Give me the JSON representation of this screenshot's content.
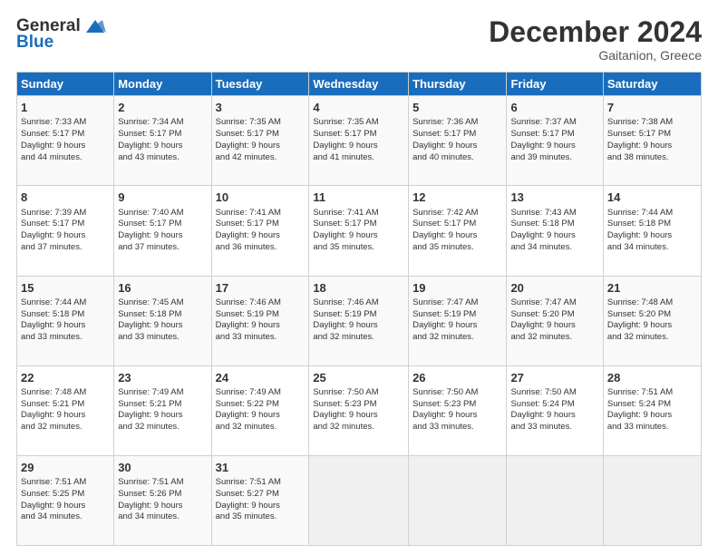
{
  "header": {
    "logo_line1": "General",
    "logo_line2": "Blue",
    "month_title": "December 2024",
    "location": "Gaitanion, Greece"
  },
  "days_of_week": [
    "Sunday",
    "Monday",
    "Tuesday",
    "Wednesday",
    "Thursday",
    "Friday",
    "Saturday"
  ],
  "weeks": [
    [
      {
        "day": "1",
        "info": "Sunrise: 7:33 AM\nSunset: 5:17 PM\nDaylight: 9 hours\nand 44 minutes."
      },
      {
        "day": "2",
        "info": "Sunrise: 7:34 AM\nSunset: 5:17 PM\nDaylight: 9 hours\nand 43 minutes."
      },
      {
        "day": "3",
        "info": "Sunrise: 7:35 AM\nSunset: 5:17 PM\nDaylight: 9 hours\nand 42 minutes."
      },
      {
        "day": "4",
        "info": "Sunrise: 7:35 AM\nSunset: 5:17 PM\nDaylight: 9 hours\nand 41 minutes."
      },
      {
        "day": "5",
        "info": "Sunrise: 7:36 AM\nSunset: 5:17 PM\nDaylight: 9 hours\nand 40 minutes."
      },
      {
        "day": "6",
        "info": "Sunrise: 7:37 AM\nSunset: 5:17 PM\nDaylight: 9 hours\nand 39 minutes."
      },
      {
        "day": "7",
        "info": "Sunrise: 7:38 AM\nSunset: 5:17 PM\nDaylight: 9 hours\nand 38 minutes."
      }
    ],
    [
      {
        "day": "8",
        "info": "Sunrise: 7:39 AM\nSunset: 5:17 PM\nDaylight: 9 hours\nand 37 minutes."
      },
      {
        "day": "9",
        "info": "Sunrise: 7:40 AM\nSunset: 5:17 PM\nDaylight: 9 hours\nand 37 minutes."
      },
      {
        "day": "10",
        "info": "Sunrise: 7:41 AM\nSunset: 5:17 PM\nDaylight: 9 hours\nand 36 minutes."
      },
      {
        "day": "11",
        "info": "Sunrise: 7:41 AM\nSunset: 5:17 PM\nDaylight: 9 hours\nand 35 minutes."
      },
      {
        "day": "12",
        "info": "Sunrise: 7:42 AM\nSunset: 5:17 PM\nDaylight: 9 hours\nand 35 minutes."
      },
      {
        "day": "13",
        "info": "Sunrise: 7:43 AM\nSunset: 5:18 PM\nDaylight: 9 hours\nand 34 minutes."
      },
      {
        "day": "14",
        "info": "Sunrise: 7:44 AM\nSunset: 5:18 PM\nDaylight: 9 hours\nand 34 minutes."
      }
    ],
    [
      {
        "day": "15",
        "info": "Sunrise: 7:44 AM\nSunset: 5:18 PM\nDaylight: 9 hours\nand 33 minutes."
      },
      {
        "day": "16",
        "info": "Sunrise: 7:45 AM\nSunset: 5:18 PM\nDaylight: 9 hours\nand 33 minutes."
      },
      {
        "day": "17",
        "info": "Sunrise: 7:46 AM\nSunset: 5:19 PM\nDaylight: 9 hours\nand 33 minutes."
      },
      {
        "day": "18",
        "info": "Sunrise: 7:46 AM\nSunset: 5:19 PM\nDaylight: 9 hours\nand 32 minutes."
      },
      {
        "day": "19",
        "info": "Sunrise: 7:47 AM\nSunset: 5:19 PM\nDaylight: 9 hours\nand 32 minutes."
      },
      {
        "day": "20",
        "info": "Sunrise: 7:47 AM\nSunset: 5:20 PM\nDaylight: 9 hours\nand 32 minutes."
      },
      {
        "day": "21",
        "info": "Sunrise: 7:48 AM\nSunset: 5:20 PM\nDaylight: 9 hours\nand 32 minutes."
      }
    ],
    [
      {
        "day": "22",
        "info": "Sunrise: 7:48 AM\nSunset: 5:21 PM\nDaylight: 9 hours\nand 32 minutes."
      },
      {
        "day": "23",
        "info": "Sunrise: 7:49 AM\nSunset: 5:21 PM\nDaylight: 9 hours\nand 32 minutes."
      },
      {
        "day": "24",
        "info": "Sunrise: 7:49 AM\nSunset: 5:22 PM\nDaylight: 9 hours\nand 32 minutes."
      },
      {
        "day": "25",
        "info": "Sunrise: 7:50 AM\nSunset: 5:23 PM\nDaylight: 9 hours\nand 32 minutes."
      },
      {
        "day": "26",
        "info": "Sunrise: 7:50 AM\nSunset: 5:23 PM\nDaylight: 9 hours\nand 33 minutes."
      },
      {
        "day": "27",
        "info": "Sunrise: 7:50 AM\nSunset: 5:24 PM\nDaylight: 9 hours\nand 33 minutes."
      },
      {
        "day": "28",
        "info": "Sunrise: 7:51 AM\nSunset: 5:24 PM\nDaylight: 9 hours\nand 33 minutes."
      }
    ],
    [
      {
        "day": "29",
        "info": "Sunrise: 7:51 AM\nSunset: 5:25 PM\nDaylight: 9 hours\nand 34 minutes."
      },
      {
        "day": "30",
        "info": "Sunrise: 7:51 AM\nSunset: 5:26 PM\nDaylight: 9 hours\nand 34 minutes."
      },
      {
        "day": "31",
        "info": "Sunrise: 7:51 AM\nSunset: 5:27 PM\nDaylight: 9 hours\nand 35 minutes."
      },
      {
        "day": "",
        "info": ""
      },
      {
        "day": "",
        "info": ""
      },
      {
        "day": "",
        "info": ""
      },
      {
        "day": "",
        "info": ""
      }
    ]
  ]
}
